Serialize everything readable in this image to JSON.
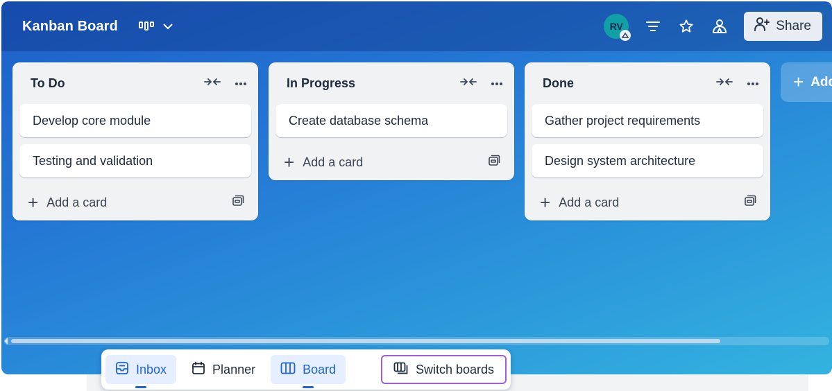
{
  "header": {
    "board_title": "Kanban Board",
    "avatar_initials": "RV",
    "share_label": "Share"
  },
  "lists": [
    {
      "title": "To Do",
      "cards": [
        "Develop core module",
        "Testing and validation"
      ],
      "add_card_label": "Add a card"
    },
    {
      "title": "In Progress",
      "cards": [
        "Create database schema"
      ],
      "add_card_label": "Add a card"
    },
    {
      "title": "Done",
      "cards": [
        "Gather project requirements",
        "Design system architecture"
      ],
      "add_card_label": "Add a card"
    }
  ],
  "add_list_label": "Add",
  "bottom_nav": {
    "inbox": "Inbox",
    "planner": "Planner",
    "board": "Board",
    "switch_boards": "Switch boards"
  },
  "colors": {
    "accent": "#1d63d6",
    "switch_outline": "#a35bd6",
    "avatar": "#10a0a6"
  }
}
